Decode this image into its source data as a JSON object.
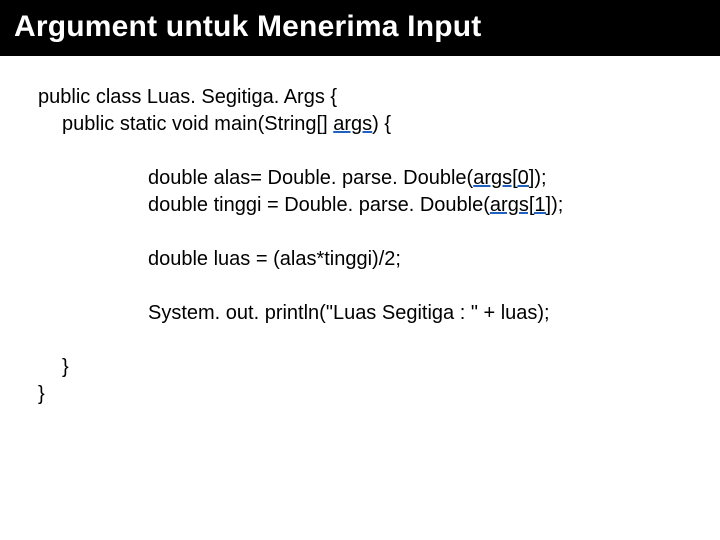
{
  "header": {
    "title": "Argument untuk Menerima Input"
  },
  "code": {
    "line1": "public class Luas. Segitiga. Args {",
    "line2a": "public static void main(String[] ",
    "line2b": "args",
    "line2c": ") {",
    "line3a": "double alas= Double. parse. Double(",
    "line3b": "args[0]",
    "line3c": ");",
    "line4a": "double tinggi = Double. parse. Double(",
    "line4b": "args[1]",
    "line4c": ");",
    "line5": "double luas = (alas*tinggi)/2;",
    "line6": "System. out. println(\"Luas Segitiga : \" + luas);",
    "line7": "}",
    "line8": "}"
  }
}
